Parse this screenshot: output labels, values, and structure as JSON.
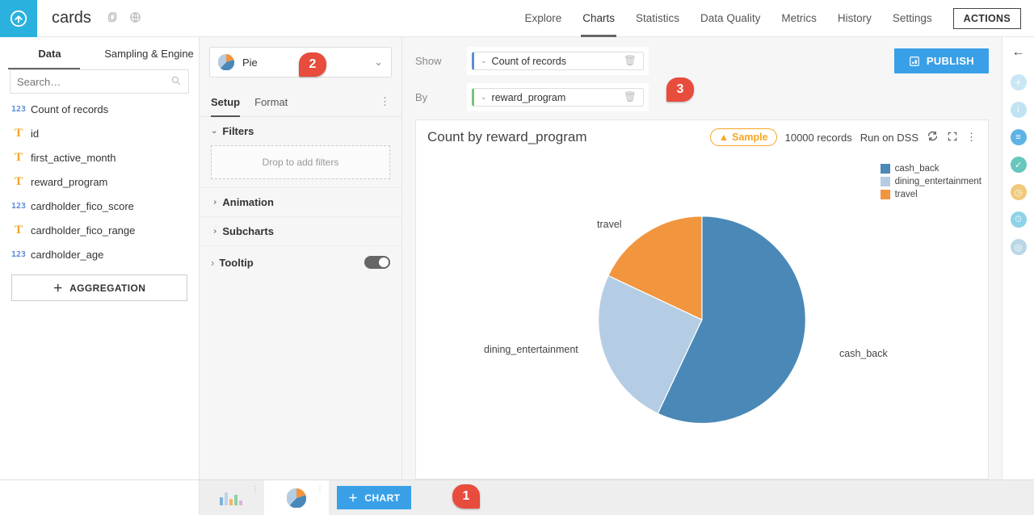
{
  "header": {
    "dataset_name": "cards",
    "tabs": [
      "Explore",
      "Charts",
      "Statistics",
      "Data Quality",
      "Metrics",
      "History",
      "Settings"
    ],
    "active_tab": "Charts",
    "actions_label": "ACTIONS"
  },
  "left_panel": {
    "tabs": [
      "Data",
      "Sampling & Engine"
    ],
    "active_tab": "Data",
    "search_placeholder": "Search…",
    "fields": [
      {
        "type": "num",
        "name": "Count of records"
      },
      {
        "type": "str",
        "name": "id"
      },
      {
        "type": "str",
        "name": "first_active_month"
      },
      {
        "type": "str",
        "name": "reward_program"
      },
      {
        "type": "num",
        "name": "cardholder_fico_score"
      },
      {
        "type": "str",
        "name": "cardholder_fico_range"
      },
      {
        "type": "num",
        "name": "cardholder_age"
      }
    ],
    "aggregation_label": "AGGREGATION"
  },
  "config": {
    "chart_type": "Pie",
    "tabs": [
      "Setup",
      "Format"
    ],
    "active_tab": "Setup",
    "sections": {
      "filters": {
        "label": "Filters",
        "drop_hint": "Drop to add filters"
      },
      "animation": {
        "label": "Animation"
      },
      "subcharts": {
        "label": "Subcharts"
      },
      "tooltip": {
        "label": "Tooltip",
        "enabled": true
      }
    }
  },
  "shelves": {
    "show_label": "Show",
    "by_label": "By",
    "show_pill": "Count of records",
    "by_pill": "reward_program",
    "publish_label": "PUBLISH"
  },
  "chart": {
    "title": "Count by reward_program",
    "sample_label": "Sample",
    "records_label": "10000 records",
    "run_label": "Run on DSS",
    "legend": [
      "cash_back",
      "dining_entertainment",
      "travel"
    ]
  },
  "bottom": {
    "add_chart_label": "CHART"
  },
  "callouts": {
    "b1": "1",
    "b2": "2",
    "b3": "3"
  },
  "colors": {
    "cash_back": "#4a88b7",
    "dining_entertainment": "#b4cde4",
    "travel": "#f2953f"
  },
  "chart_data": {
    "type": "pie",
    "title": "Count by reward_program",
    "series": [
      {
        "name": "cash_back",
        "value": 57
      },
      {
        "name": "dining_entertainment",
        "value": 25
      },
      {
        "name": "travel",
        "value": 18
      }
    ],
    "sample_size": 10000,
    "units": "% of records (approx.)"
  }
}
